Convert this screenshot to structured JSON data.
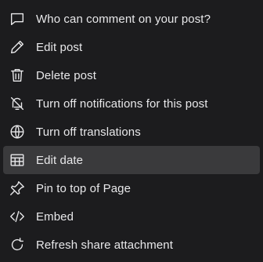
{
  "menu": {
    "items": [
      {
        "label": "Who can comment on your post?",
        "icon": "comment-icon"
      },
      {
        "label": "Edit post",
        "icon": "pencil-icon"
      },
      {
        "label": "Delete post",
        "icon": "trash-icon"
      },
      {
        "label": "Turn off notifications for this post",
        "icon": "bell-off-icon"
      },
      {
        "label": "Turn off translations",
        "icon": "globe-translate-icon"
      },
      {
        "label": "Edit date",
        "icon": "calendar-icon",
        "selected": true
      },
      {
        "label": "Pin to top of Page",
        "icon": "pin-icon"
      },
      {
        "label": "Embed",
        "icon": "code-icon"
      },
      {
        "label": "Refresh share attachment",
        "icon": "refresh-icon"
      }
    ]
  },
  "colors": {
    "background": "#1c1c1e",
    "text": "#e8e8ea",
    "highlight": "#3a3a3c"
  }
}
